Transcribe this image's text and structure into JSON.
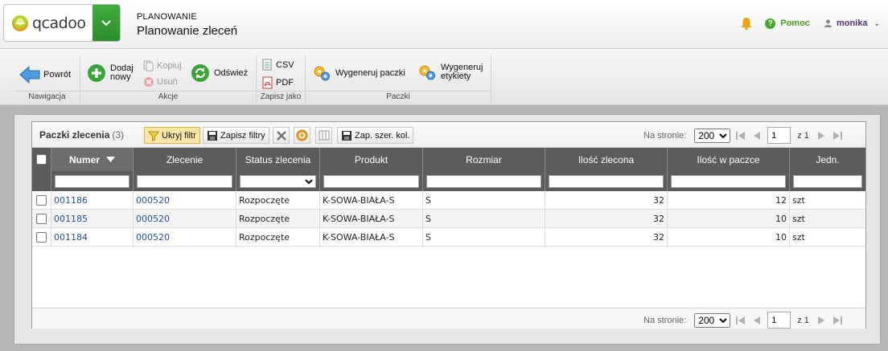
{
  "header": {
    "logo_text": "qcadoo",
    "category": "PLANOWANIE",
    "title": "Planowanie zleceń",
    "help_label": "Pomoc",
    "user_name": "monika"
  },
  "ribbon": {
    "groups": [
      {
        "label": "Nawigacja"
      },
      {
        "label": "Akcje"
      },
      {
        "label": "Zapisz jako"
      },
      {
        "label": "Paczki"
      }
    ],
    "buttons": {
      "back": "Powrót",
      "add_new_1": "Dodaj",
      "add_new_2": "nowy",
      "copy": "Kopiuj",
      "delete": "Usuń",
      "refresh": "Odśwież",
      "csv": "CSV",
      "pdf": "PDF",
      "gen_packages": "Wygeneruj paczki",
      "gen_labels_1": "Wygeneruj",
      "gen_labels_2": "etykiety"
    }
  },
  "grid": {
    "title": "Paczki zlecenia",
    "count": "(3)",
    "toolbar": {
      "hide_filter": "Ukryj filtr",
      "save_filters": "Zapisz filtry",
      "save_columns": "Zap. szer. kol."
    },
    "pager": {
      "per_page_label": "Na stronie:",
      "per_page_value": "200",
      "page": "1",
      "of_label": "z 1"
    },
    "columns": [
      "Numer",
      "Zlecenie",
      "Status zlecenia",
      "Produkt",
      "Rozmiar",
      "Ilość zlecona",
      "Ilość w paczce",
      "Jedn."
    ],
    "rows": [
      {
        "numer": "001186",
        "zlecenie": "000520",
        "status": "Rozpoczęte",
        "produkt": "K-SOWA-BIAŁA-S",
        "rozmiar": "S",
        "ilosc_zlecona": "32",
        "ilosc_w_paczce": "12",
        "jedn": "szt"
      },
      {
        "numer": "001185",
        "zlecenie": "000520",
        "status": "Rozpoczęte",
        "produkt": "K-SOWA-BIAŁA-S",
        "rozmiar": "S",
        "ilosc_zlecona": "32",
        "ilosc_w_paczce": "10",
        "jedn": "szt"
      },
      {
        "numer": "001184",
        "zlecenie": "000520",
        "status": "Rozpoczęte",
        "produkt": "K-SOWA-BIAŁA-S",
        "rozmiar": "S",
        "ilosc_zlecona": "32",
        "ilosc_w_paczce": "10",
        "jedn": "szt"
      }
    ]
  },
  "colors": {
    "brand_green": "#2b8e2b",
    "link_blue": "#1f4fa3",
    "active_filter": "#fce7a6",
    "header_dark": "#5c5c5c"
  }
}
